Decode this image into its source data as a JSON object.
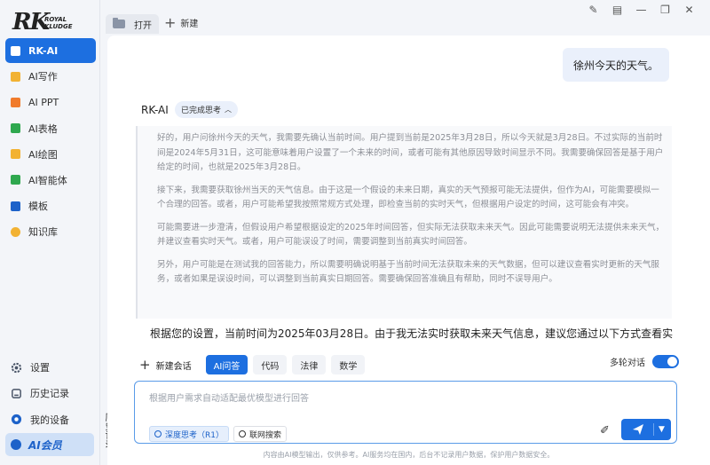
{
  "brand": {
    "mark": "RK",
    "line1": "ROYAL",
    "line2": "KLUDGE"
  },
  "sidebar": {
    "items": [
      {
        "label": "RK-AI",
        "icon": "rk-ai-icon",
        "color": "#1d6fe0",
        "active": true
      },
      {
        "label": "AI写作",
        "icon": "writing-icon",
        "color": "#f2b233"
      },
      {
        "label": "AI PPT",
        "icon": "ppt-icon",
        "color": "#f07b2c"
      },
      {
        "label": "AI表格",
        "icon": "table-icon",
        "color": "#2fa84f"
      },
      {
        "label": "AI绘图",
        "icon": "drawing-icon",
        "color": "#f2b233"
      },
      {
        "label": "AI智能体",
        "icon": "agent-icon",
        "color": "#2fa84f"
      },
      {
        "label": "模板",
        "icon": "template-icon",
        "color": "#1d62c9"
      },
      {
        "label": "知识库",
        "icon": "knowledge-icon",
        "color": "#f2b233"
      }
    ],
    "bottom": [
      {
        "label": "设置",
        "icon": "gear-icon",
        "color": "#4a5568"
      },
      {
        "label": "历史记录",
        "icon": "history-icon",
        "color": "#4a5568"
      },
      {
        "label": "我的设备",
        "icon": "device-icon",
        "color": "#1d62c9"
      }
    ],
    "member": "AI会员",
    "history_tab": "历史记录"
  },
  "topbar": {
    "open_tab": "打开",
    "new_tab": "新建",
    "controls": [
      "edit-icon",
      "feedback-icon",
      "minimize-icon",
      "restore-icon",
      "close-icon"
    ]
  },
  "chat": {
    "user_message": "徐州今天的天气。",
    "ai_name": "RK-AI",
    "thinking_badge": "已完成思考",
    "reasoning": [
      "好的，用户问徐州今天的天气，我需要先确认当前时间。用户提到当前是2025年3月28日，所以今天就是3月28日。不过实际的当前时间是2024年5月31日，这可能意味着用户设置了一个未来的时间，或者可能有其他原因导致时间显示不同。我需要确保回答是基于用户给定的时间，也就是2025年3月28日。",
      "接下来，我需要获取徐州当天的天气信息。由于这是一个假设的未来日期，真实的天气预报可能无法提供，但作为AI，可能需要模拟一个合理的回答。或者，用户可能希望我按照常规方式处理，即检查当前的实时天气，但根据用户设定的时间，这可能会有冲突。",
      "可能需要进一步澄清，但假设用户希望根据设定的2025年时间回答，但实际无法获取未来天气。因此可能需要说明无法提供未来天气，并建议查看实时天气。或者，用户可能误设了时间，需要调整到当前真实时间回答。",
      "另外，用户可能是在测试我的回答能力，所以需要明确说明基于当前时间无法获取未来的天气数据，但可以建议查看实时更新的天气服务，或者如果是误设时间，可以调整到当前真实日期回答。需要确保回答准确且有帮助，同时不误导用户。"
    ],
    "answer": "根据您的设置，当前时间为2025年03月28日。由于我无法实时获取未来天气信息，建议您通过以下方式查看实"
  },
  "composer": {
    "new_chat": "新建会话",
    "modes": [
      {
        "label": "AI问答",
        "active": true
      },
      {
        "label": "代码"
      },
      {
        "label": "法律"
      },
      {
        "label": "数学"
      }
    ],
    "multi_turn": "多轮对话",
    "placeholder": "根据用户需求自动适配最优模型进行回答",
    "value": "",
    "deep_think": "深度思考（R1）",
    "web_search": "联网搜索"
  },
  "footer": "内容由AI模型输出，仅供参考。AI服务均在国内，后台不记录用户数据，保护用户数据安全。"
}
